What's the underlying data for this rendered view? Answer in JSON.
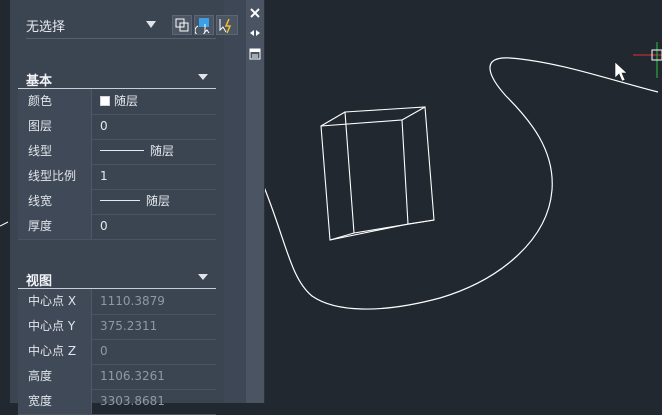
{
  "palette": {
    "selection": "无选择",
    "sections": {
      "basic": {
        "title": "基本",
        "rows": [
          {
            "label": "颜色",
            "value": "随层"
          },
          {
            "label": "图层",
            "value": "0"
          },
          {
            "label": "线型",
            "value": "随层"
          },
          {
            "label": "线型比例",
            "value": "1"
          },
          {
            "label": "线宽",
            "value": "随层"
          },
          {
            "label": "厚度",
            "value": "0"
          }
        ]
      },
      "view": {
        "title": "视图",
        "rows": [
          {
            "label": "中心点 X",
            "value": "1110.3879"
          },
          {
            "label": "中心点 Y",
            "value": "375.2311"
          },
          {
            "label": "中心点 Z",
            "value": "0"
          },
          {
            "label": "高度",
            "value": "1106.3261"
          },
          {
            "label": "宽度",
            "value": "3303.8681"
          }
        ]
      }
    }
  },
  "colors": {
    "canvas": "#212830",
    "panel": "#3b4451",
    "geometry": "#ffffff",
    "ucs_x": "#e03030",
    "ucs_y": "#30c040"
  },
  "icons": [
    "close-icon",
    "auto-hide-icon",
    "properties-icon",
    "quick-select-icon",
    "select-objects-icon",
    "toggle-pickadd-icon",
    "mouse-cursor-icon"
  ]
}
